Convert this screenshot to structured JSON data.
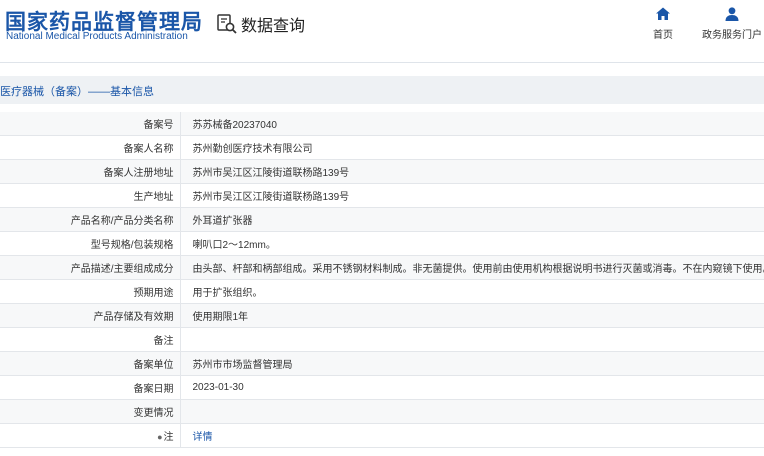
{
  "header": {
    "logo_cn": "国家药品监督管理局",
    "logo_en": "National Medical Products Administration",
    "query_label": "数据查询",
    "nav": [
      {
        "label": "首页",
        "icon": "home-icon"
      },
      {
        "label": "政务服务门户",
        "icon": "user-icon"
      }
    ]
  },
  "breadcrumb": "医疗器械（备案）——基本信息",
  "rows": [
    {
      "label": "备案号",
      "value": "苏苏械备20237040"
    },
    {
      "label": "备案人名称",
      "value": "苏州勤创医疗技术有限公司"
    },
    {
      "label": "备案人注册地址",
      "value": "苏州市吴江区江陵街道联杨路139号"
    },
    {
      "label": "生产地址",
      "value": "苏州市吴江区江陵街道联杨路139号"
    },
    {
      "label": "产品名称/产品分类名称",
      "value": "外耳道扩张器"
    },
    {
      "label": "型号规格/包装规格",
      "value": "喇叭口2～12mm。"
    },
    {
      "label": "产品描述/主要组成成分",
      "value": "由头部、杆部和柄部组成。采用不锈钢材料制成。非无菌提供。使用前由使用机构根据说明书进行灭菌或消毒。不在内窥镜下使用。"
    },
    {
      "label": "预期用途",
      "value": "用于扩张组织。"
    },
    {
      "label": "产品存储及有效期",
      "value": "使用期限1年"
    },
    {
      "label": "备注",
      "value": ""
    },
    {
      "label": "备案单位",
      "value": "苏州市市场监督管理局"
    },
    {
      "label": "备案日期",
      "value": "2023-01-30"
    },
    {
      "label": "变更情况",
      "value": ""
    }
  ],
  "note": {
    "label": "注",
    "icon": "pin-icon",
    "link": "详情"
  },
  "colors": {
    "brand": "#1a56a8",
    "band": "#eef1f4",
    "row_alt": "#f7f8f9"
  }
}
